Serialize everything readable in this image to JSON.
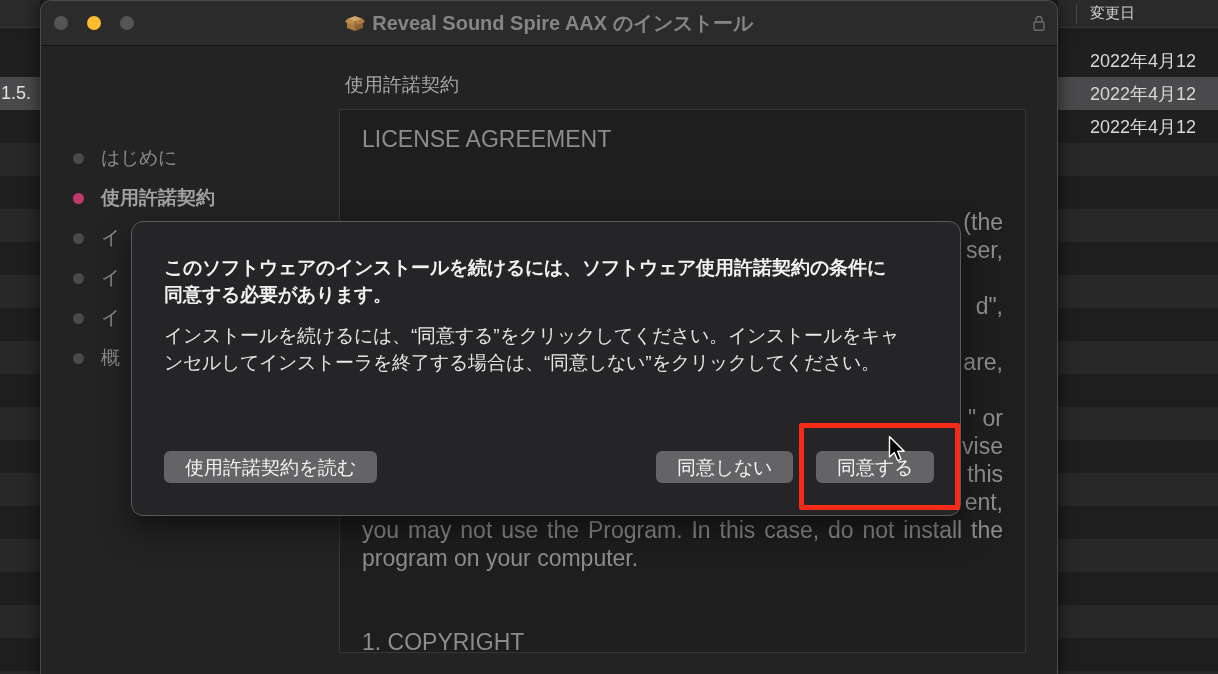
{
  "background_window": {
    "column_header": "変更日",
    "rows": [
      {
        "date": "2022年4月12",
        "selected": false
      },
      {
        "name": "1.5.",
        "date": "2022年4月12",
        "selected": true
      },
      {
        "date": "2022年4月12",
        "selected": false
      }
    ]
  },
  "window": {
    "title": "Reveal Sound Spire AAX のインストール",
    "controls": [
      {
        "disabled": true
      },
      {
        "disabled": false
      },
      {
        "disabled": true
      }
    ]
  },
  "steps": [
    {
      "label": "はじめに",
      "selected": false
    },
    {
      "label": "使用許諾契約",
      "selected": true
    },
    {
      "label": "イ",
      "selected": false
    },
    {
      "label": "イ",
      "selected": false
    },
    {
      "label": "イ",
      "selected": false
    },
    {
      "label": "概",
      "selected": false
    }
  ],
  "page_heading": "使用許諾契約",
  "license": {
    "heading": "LICENSE AGREEMENT",
    "line_ends": [
      "(the",
      "ser,",
      "d\",",
      "are,",
      "\" or",
      "vise",
      "this",
      "ent,"
    ],
    "paragraph": "you may not use the Program. In this case, do not install the program on your computer.",
    "section_heading": "1. COPYRIGHT"
  },
  "dialog": {
    "title": "このソフトウェアのインストールを続けるには、ソフトウェア使用許諾契約の条件に同意する必要があります。",
    "message": "インストールを続けるには、“同意する”をクリックしてください。インストールをキャンセルしてインストーラを終了する場合は、“同意しない”をクリックしてください。",
    "buttons": [
      {
        "label": "使用許諾契約を読む",
        "highlighted": false
      },
      {
        "label": "同意しない",
        "highlighted": false
      },
      {
        "label": "同意する",
        "highlighted": true
      }
    ]
  }
}
